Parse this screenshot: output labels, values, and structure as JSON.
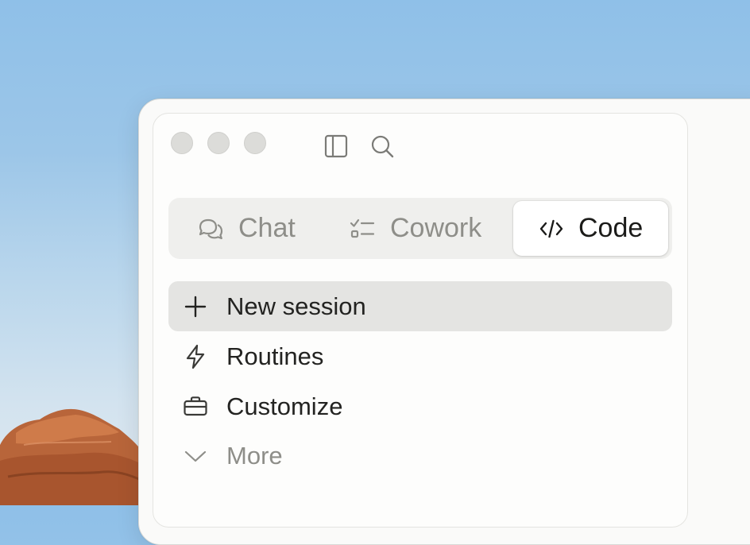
{
  "window": {
    "traffic_lights": [
      "close",
      "minimize",
      "zoom"
    ],
    "toolbar_icons": [
      "sidebar-toggle-icon",
      "search-icon"
    ]
  },
  "mode_tabs": {
    "selected": "Code",
    "items": [
      {
        "label": "Chat",
        "icon": "chat-bubbles-icon"
      },
      {
        "label": "Cowork",
        "icon": "checklist-icon"
      },
      {
        "label": "Code",
        "icon": "code-icon"
      }
    ]
  },
  "menu": {
    "items": [
      {
        "label": "New session",
        "icon": "plus-icon",
        "highlighted": true
      },
      {
        "label": "Routines",
        "icon": "lightning-icon"
      },
      {
        "label": "Customize",
        "icon": "briefcase-icon"
      },
      {
        "label": "More",
        "icon": "chevron-down-icon",
        "muted": true
      }
    ]
  },
  "colors": {
    "text": "#232321",
    "muted_text": "#8e8e89",
    "highlight": "#e4e4e2",
    "segment_bg": "#efefed"
  }
}
